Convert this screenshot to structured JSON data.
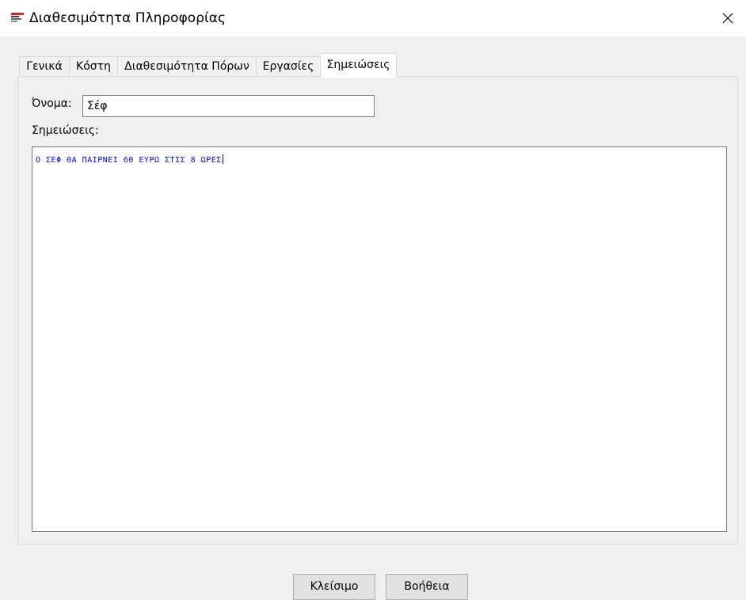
{
  "window": {
    "title": "Διαθεσιμότητα Πληροφορίας",
    "close_glyph": "✕",
    "app_icon": "app-logo-icon"
  },
  "tabs": [
    {
      "label": "Γενικά",
      "active": false
    },
    {
      "label": "Κόστη",
      "active": false
    },
    {
      "label": "Διαθεσιμότητα Πόρων",
      "active": false
    },
    {
      "label": "Εργασίες",
      "active": false
    },
    {
      "label": "Σημειώσεις",
      "active": true
    }
  ],
  "form": {
    "name_label": "Όνομα:",
    "name_value": "Σέφ",
    "notes_label": "Σημειώσεις:",
    "notes_value": "Ο ΣΕΦ ΘΑ ΠΑΙΡΝΕΙ 60 ΕΥΡΩ ΣΤΙΣ 8 ΩΡΕΣ"
  },
  "buttons": {
    "close_label": "Κλείσιμο",
    "help_label": "Βοήθεια"
  },
  "colors": {
    "notes_text": "#0000ff",
    "window_bg": "#f0f0f0"
  }
}
